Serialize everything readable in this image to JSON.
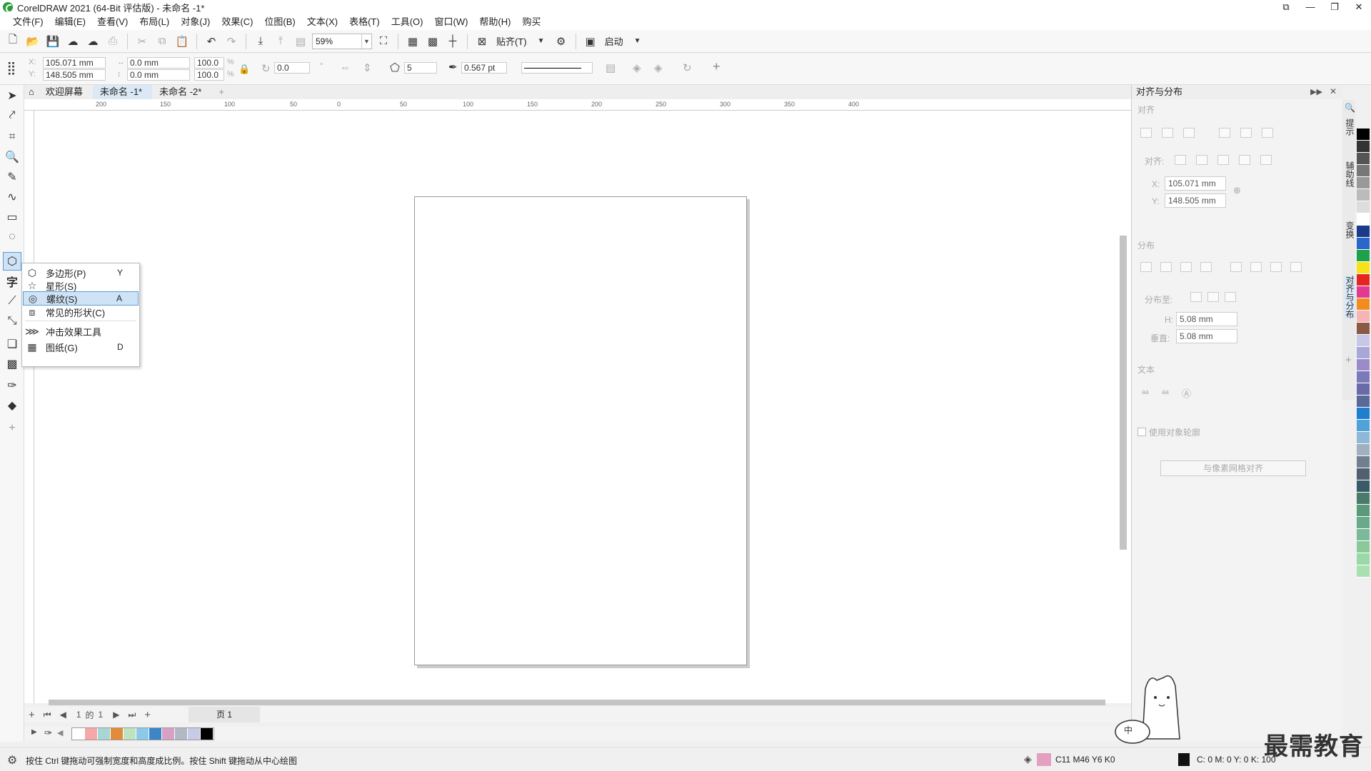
{
  "window": {
    "title": "CorelDRAW 2021 (64-Bit 评估版) - 未命名 -1*"
  },
  "menu": [
    "文件(F)",
    "编辑(E)",
    "查看(V)",
    "布局(L)",
    "对象(J)",
    "效果(C)",
    "位图(B)",
    "文本(X)",
    "表格(T)",
    "工具(O)",
    "窗口(W)",
    "帮助(H)",
    "购买"
  ],
  "toolbar1": {
    "zoom": "59%",
    "snap_label": "贴齐(T)",
    "launch_label": "启动"
  },
  "toolbar2": {
    "x": "105.071 mm",
    "y": "148.505 mm",
    "w": "0.0 mm",
    "h": "0.0 mm",
    "sx": "100.0",
    "sy": "100.0",
    "angle": "0.0",
    "sides": "5",
    "outline": "0.567 pt"
  },
  "tabs": [
    "欢迎屏幕",
    "未命名 -1*",
    "未命名 -2*"
  ],
  "ruler_h": [
    "200",
    "150",
    "100",
    "50",
    "0",
    "50",
    "100",
    "150",
    "200",
    "250",
    "300",
    "350",
    "400"
  ],
  "flyout": [
    {
      "label": "多边形(P)",
      "shortcut": "Y",
      "icon": "polygon-icon"
    },
    {
      "label": "星形(S)",
      "shortcut": "",
      "icon": "star-icon"
    },
    {
      "label": "螺纹(S)",
      "shortcut": "A",
      "icon": "spiral-icon"
    },
    {
      "label": "常见的形状(C)",
      "shortcut": "",
      "icon": "common-shapes-icon"
    },
    {
      "label": "冲击效果工具",
      "shortcut": "",
      "icon": "impact-icon"
    },
    {
      "label": "图纸(G)",
      "shortcut": "D",
      "icon": "graph-paper-icon"
    }
  ],
  "pagebar": {
    "current": "1",
    "of": "的",
    "total": "1",
    "page_tab": "页 1"
  },
  "docker": {
    "title": "对齐与分布",
    "sec_align": "对齐",
    "sec_align_to": "对齐:",
    "x_label": "X:",
    "x_value": "105.071 mm",
    "y_label": "Y:",
    "y_value": "148.505 mm",
    "sec_distribute": "分布",
    "sec_distribute_to": "分布至:",
    "h_label": "H:",
    "h_value": "5.08 mm",
    "v_label": "垂直:",
    "v_value": "5.08 mm",
    "sec_text": "文本",
    "use_outline": "使用对象轮廓",
    "pixel_grid_btn": "与像素网格对齐"
  },
  "docker_tabs": [
    "提示",
    "辅助线",
    "变换",
    "对齐与分布"
  ],
  "status": {
    "hint": "按住 Ctrl 键拖动可强制宽度和高度成比例。按住 Shift 键拖动从中心绘图",
    "fill_info": "C11 M46 Y6 K0",
    "outline_info": "C: 0 M: 0 Y: 0 K: 100"
  },
  "watermark": "最需教育",
  "colors": {
    "bottom_palette": [
      "#ffffff",
      "#f4a9a8",
      "#a6d6d6",
      "#e28b3a",
      "#bfe3c0",
      "#8cc9e8",
      "#3b86c8",
      "#d9a0c6",
      "#b2b8c4",
      "#c9c9e8",
      "#000000"
    ],
    "right_palette": [
      "#000000",
      "#333333",
      "#555555",
      "#777777",
      "#999999",
      "#bbbbbb",
      "#dddddd",
      "#ffffff",
      "#1b3a8c",
      "#2a67c9",
      "#1fa04a",
      "#f5e21b",
      "#e52521",
      "#e23a8f",
      "#f28c1e",
      "#f8b3b3",
      "#8a5a44",
      "#c7c7e8",
      "#a8a8d8",
      "#9b8bc8",
      "#7a7aba",
      "#6a6aa8",
      "#5a6a98",
      "#1e7fd0",
      "#4fa3d8",
      "#8fb8d8",
      "#a0b0c0",
      "#708090",
      "#506070",
      "#3a5a6a",
      "#4a7a6a",
      "#5a9a7a",
      "#6aaa8a",
      "#7aba9a",
      "#8aca9a",
      "#9ad8a8",
      "#a8e0b0"
    ]
  }
}
